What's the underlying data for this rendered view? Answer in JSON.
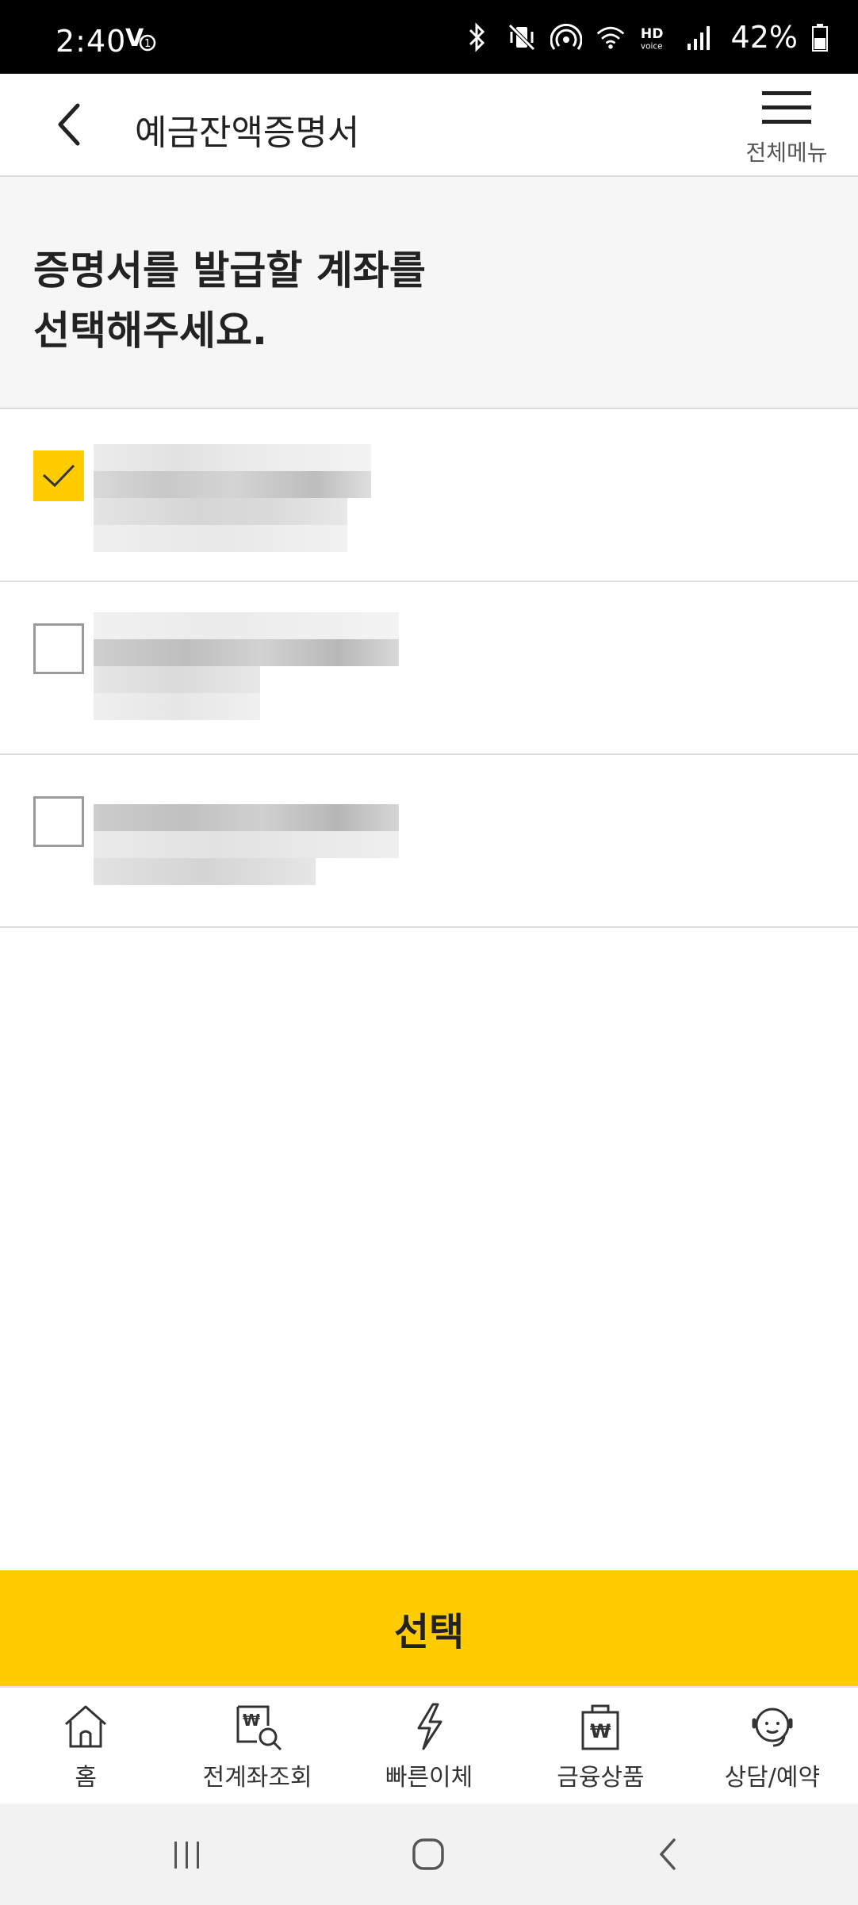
{
  "status_bar": {
    "time": "2:40",
    "battery": "42%",
    "icons": [
      "bluetooth-icon",
      "vibrate-mute-icon",
      "hotspot-icon",
      "wifi-icon",
      "hd-voice-icon",
      "signal-icon",
      "battery-icon"
    ]
  },
  "header": {
    "title": "예금잔액증명서",
    "menu_label": "전체메뉴"
  },
  "intro": {
    "line1": "증명서를 발급할 계좌를",
    "line2": "선택해주세요."
  },
  "accounts": [
    {
      "checked": true
    },
    {
      "checked": false
    },
    {
      "checked": false
    }
  ],
  "select_button": {
    "label": "선택"
  },
  "bottom_nav": {
    "items": [
      {
        "label": "홈",
        "icon": "home-icon"
      },
      {
        "label": "전계좌조회",
        "icon": "account-search-icon"
      },
      {
        "label": "빠른이체",
        "icon": "lightning-icon"
      },
      {
        "label": "금융상품",
        "icon": "shopping-bag-icon"
      },
      {
        "label": "상담/예약",
        "icon": "headset-icon"
      }
    ]
  },
  "colors": {
    "accent": "#ffcc00",
    "divider": "#dcdcdc",
    "intro_bg": "#f6f6f6"
  }
}
